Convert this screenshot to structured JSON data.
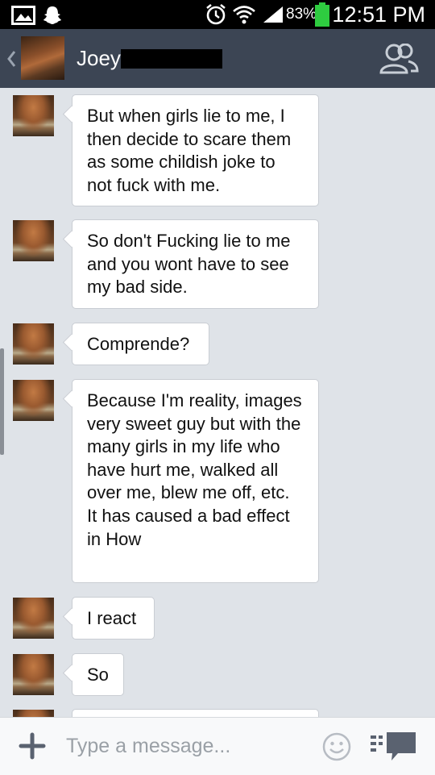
{
  "status_bar": {
    "battery_percent": "83%",
    "time": "12:51 PM",
    "icons": [
      "gallery-icon",
      "snapchat-icon",
      "alarm-icon",
      "wifi-icon",
      "signal-icon",
      "battery-icon"
    ]
  },
  "header": {
    "contact_name": "Joey",
    "name_suffix": " .."
  },
  "messages": [
    {
      "text": "But when girls lie to me, I then decide to scare them as some childish joke to not fuck with me."
    },
    {
      "text": "So don't Fucking lie to me and you wont have to see my bad side."
    },
    {
      "text": "Comprende?"
    },
    {
      "text": "Because I'm reality, images very sweet guy but with the many girls in my life who have hurt me, walked all over me, blew me off, etc. It has caused a bad effect in How"
    },
    {
      "text": "I react"
    },
    {
      "text": "So"
    }
  ],
  "input": {
    "placeholder": "Type a message..."
  },
  "colors": {
    "header_bg": "#3c4554",
    "chat_bg": "#dfe3e8",
    "battery": "#2ecc40"
  }
}
